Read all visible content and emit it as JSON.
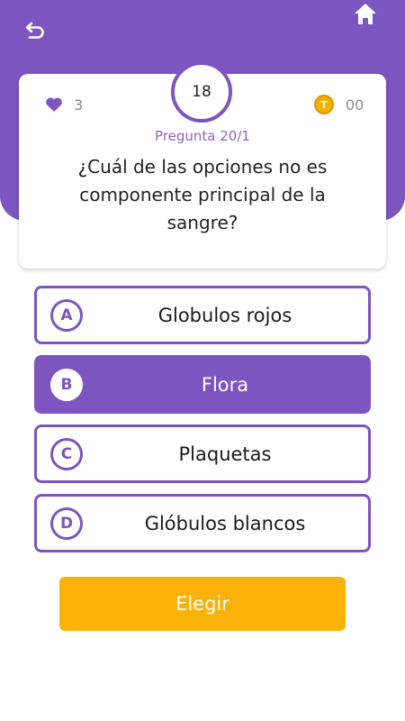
{
  "header": {
    "back_icon": "undo-arrow-icon",
    "home_icon": "home-icon"
  },
  "stats": {
    "lives": "3",
    "timer": "18",
    "coins": "00",
    "coin_symbol": "T"
  },
  "question_counter": "Pregunta 20/1",
  "question": "¿Cuál de las opciones no es componente principal de la sangre?",
  "options": [
    {
      "letter": "A",
      "text": "Globulos rojos",
      "selected": false
    },
    {
      "letter": "B",
      "text": "Flora",
      "selected": true
    },
    {
      "letter": "C",
      "text": "Plaquetas",
      "selected": false
    },
    {
      "letter": "D",
      "text": "Glóbulos blancos",
      "selected": false
    }
  ],
  "choose_button": "Elegir",
  "colors": {
    "primary": "#7d55c0",
    "accent": "#fab10a"
  }
}
